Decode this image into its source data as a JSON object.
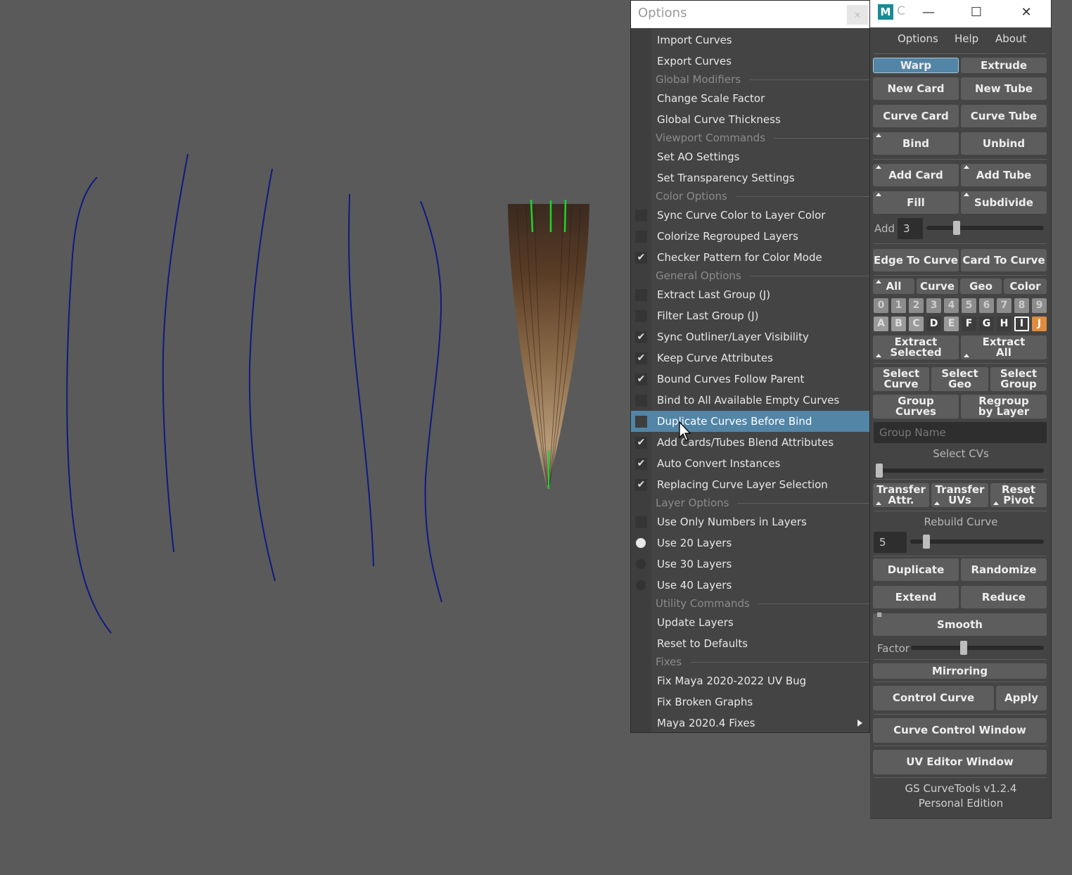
{
  "options_menu": {
    "title": "Options",
    "close": "×",
    "items": [
      {
        "kind": "item",
        "label": "Import Curves"
      },
      {
        "kind": "item",
        "label": "Export Curves"
      },
      {
        "kind": "section",
        "label": "Global Modifiers"
      },
      {
        "kind": "item",
        "label": "Change Scale Factor"
      },
      {
        "kind": "item",
        "label": "Global Curve Thickness"
      },
      {
        "kind": "section",
        "label": "Viewport Commands"
      },
      {
        "kind": "item",
        "label": "Set AO Settings"
      },
      {
        "kind": "item",
        "label": "Set Transparency Settings"
      },
      {
        "kind": "section",
        "label": "Color Options"
      },
      {
        "kind": "check",
        "label": "Sync Curve Color to Layer Color",
        "checked": false
      },
      {
        "kind": "check",
        "label": "Colorize Regrouped Layers",
        "checked": false
      },
      {
        "kind": "check",
        "label": "Checker Pattern for Color Mode",
        "checked": true
      },
      {
        "kind": "section",
        "label": "General Options"
      },
      {
        "kind": "check",
        "label": "Extract Last Group (J)",
        "checked": false
      },
      {
        "kind": "check",
        "label": "Filter Last Group (J)",
        "checked": false
      },
      {
        "kind": "check",
        "label": "Sync Outliner/Layer Visibility",
        "checked": true
      },
      {
        "kind": "check",
        "label": "Keep Curve Attributes",
        "checked": true
      },
      {
        "kind": "check",
        "label": "Bound Curves Follow Parent",
        "checked": true
      },
      {
        "kind": "check",
        "label": "Bind to All Available Empty Curves",
        "checked": false
      },
      {
        "kind": "check",
        "label": "Duplicate Curves Before Bind",
        "checked": false,
        "highlighted": true
      },
      {
        "kind": "check",
        "label": "Add Cards/Tubes Blend Attributes",
        "checked": true
      },
      {
        "kind": "check",
        "label": "Auto Convert Instances",
        "checked": true
      },
      {
        "kind": "check",
        "label": "Replacing Curve Layer Selection",
        "checked": true
      },
      {
        "kind": "section",
        "label": "Layer Options"
      },
      {
        "kind": "check",
        "label": "Use Only Numbers in Layers",
        "checked": false
      },
      {
        "kind": "radio",
        "label": "Use 20 Layers",
        "checked": true
      },
      {
        "kind": "radio",
        "label": "Use 30 Layers",
        "checked": false
      },
      {
        "kind": "radio",
        "label": "Use 40 Layers",
        "checked": false
      },
      {
        "kind": "section",
        "label": "Utility Commands"
      },
      {
        "kind": "item",
        "label": "Update Layers"
      },
      {
        "kind": "item",
        "label": "Reset to Defaults"
      },
      {
        "kind": "section",
        "label": "Fixes"
      },
      {
        "kind": "item",
        "label": "Fix Maya 2020-2022 UV Bug"
      },
      {
        "kind": "item",
        "label": "Fix Broken Graphs"
      },
      {
        "kind": "item",
        "label": "Maya 2020.4 Fixes",
        "submenu": true
      }
    ]
  },
  "panel": {
    "icon": "M",
    "title": "C",
    "window_buttons": {
      "minimize": "—",
      "maximize": "☐",
      "close": "✕"
    },
    "menubar": {
      "options": "Options",
      "help": "Help",
      "about": "About"
    },
    "warp": "Warp",
    "extrude": "Extrude",
    "new_card": "New Card",
    "new_tube": "New Tube",
    "curve_card": "Curve Card",
    "curve_tube": "Curve Tube",
    "bind": "Bind",
    "unbind": "Unbind",
    "add_card": "Add Card",
    "add_tube": "Add Tube",
    "fill": "Fill",
    "subdivide": "Subdivide",
    "add_label": "Add",
    "add_value": "3",
    "add_slider": 0.24,
    "edge_to_curve": "Edge To Curve",
    "card_to_curve": "Card To Curve",
    "filter_all": "All",
    "filter_curve": "Curve",
    "filter_geo": "Geo",
    "filter_color": "Color",
    "layer_numbers": [
      "0",
      "1",
      "2",
      "3",
      "4",
      "5",
      "6",
      "7",
      "8",
      "9"
    ],
    "layer_letters": [
      "A",
      "B",
      "C",
      "D",
      "E",
      "F",
      "G",
      "H",
      "I",
      "J"
    ],
    "extract_selected": [
      "Extract",
      "Selected"
    ],
    "extract_all": [
      "Extract",
      "All"
    ],
    "select_curve": [
      "Select",
      "Curve"
    ],
    "select_geo": [
      "Select",
      "Geo"
    ],
    "select_group": [
      "Select",
      "Group"
    ],
    "group_curves": [
      "Group",
      "Curves"
    ],
    "regroup_by_layer": [
      "Regroup",
      "by Layer"
    ],
    "group_name_placeholder": "Group Name",
    "select_cvs": "Select CVs",
    "select_cvs_slider": 0.0,
    "transfer_attr": [
      "Transfer",
      "Attr."
    ],
    "transfer_uvs": [
      "Transfer",
      "UVs"
    ],
    "reset_pivot": [
      "Reset",
      "Pivot"
    ],
    "rebuild_curve": "Rebuild Curve",
    "rebuild_value": "5",
    "rebuild_slider": 0.1,
    "duplicate": "Duplicate",
    "randomize": "Randomize",
    "extend": "Extend",
    "reduce": "Reduce",
    "smooth": "Smooth",
    "factor_label": "Factor",
    "factor_slider": 0.39,
    "mirroring": "Mirroring",
    "control_curve": "Control Curve",
    "apply": "Apply",
    "curve_control_window": "Curve Control Window",
    "uv_editor_window": "UV Editor Window",
    "footer_line1": "GS CurveTools v1.2.4",
    "footer_line2": "Personal Edition"
  },
  "colors": {
    "viewport_bg": "#5a5a5a",
    "curve": "#0e1a82",
    "accent": "#5285a6",
    "layer_j": "#e08c3e"
  }
}
